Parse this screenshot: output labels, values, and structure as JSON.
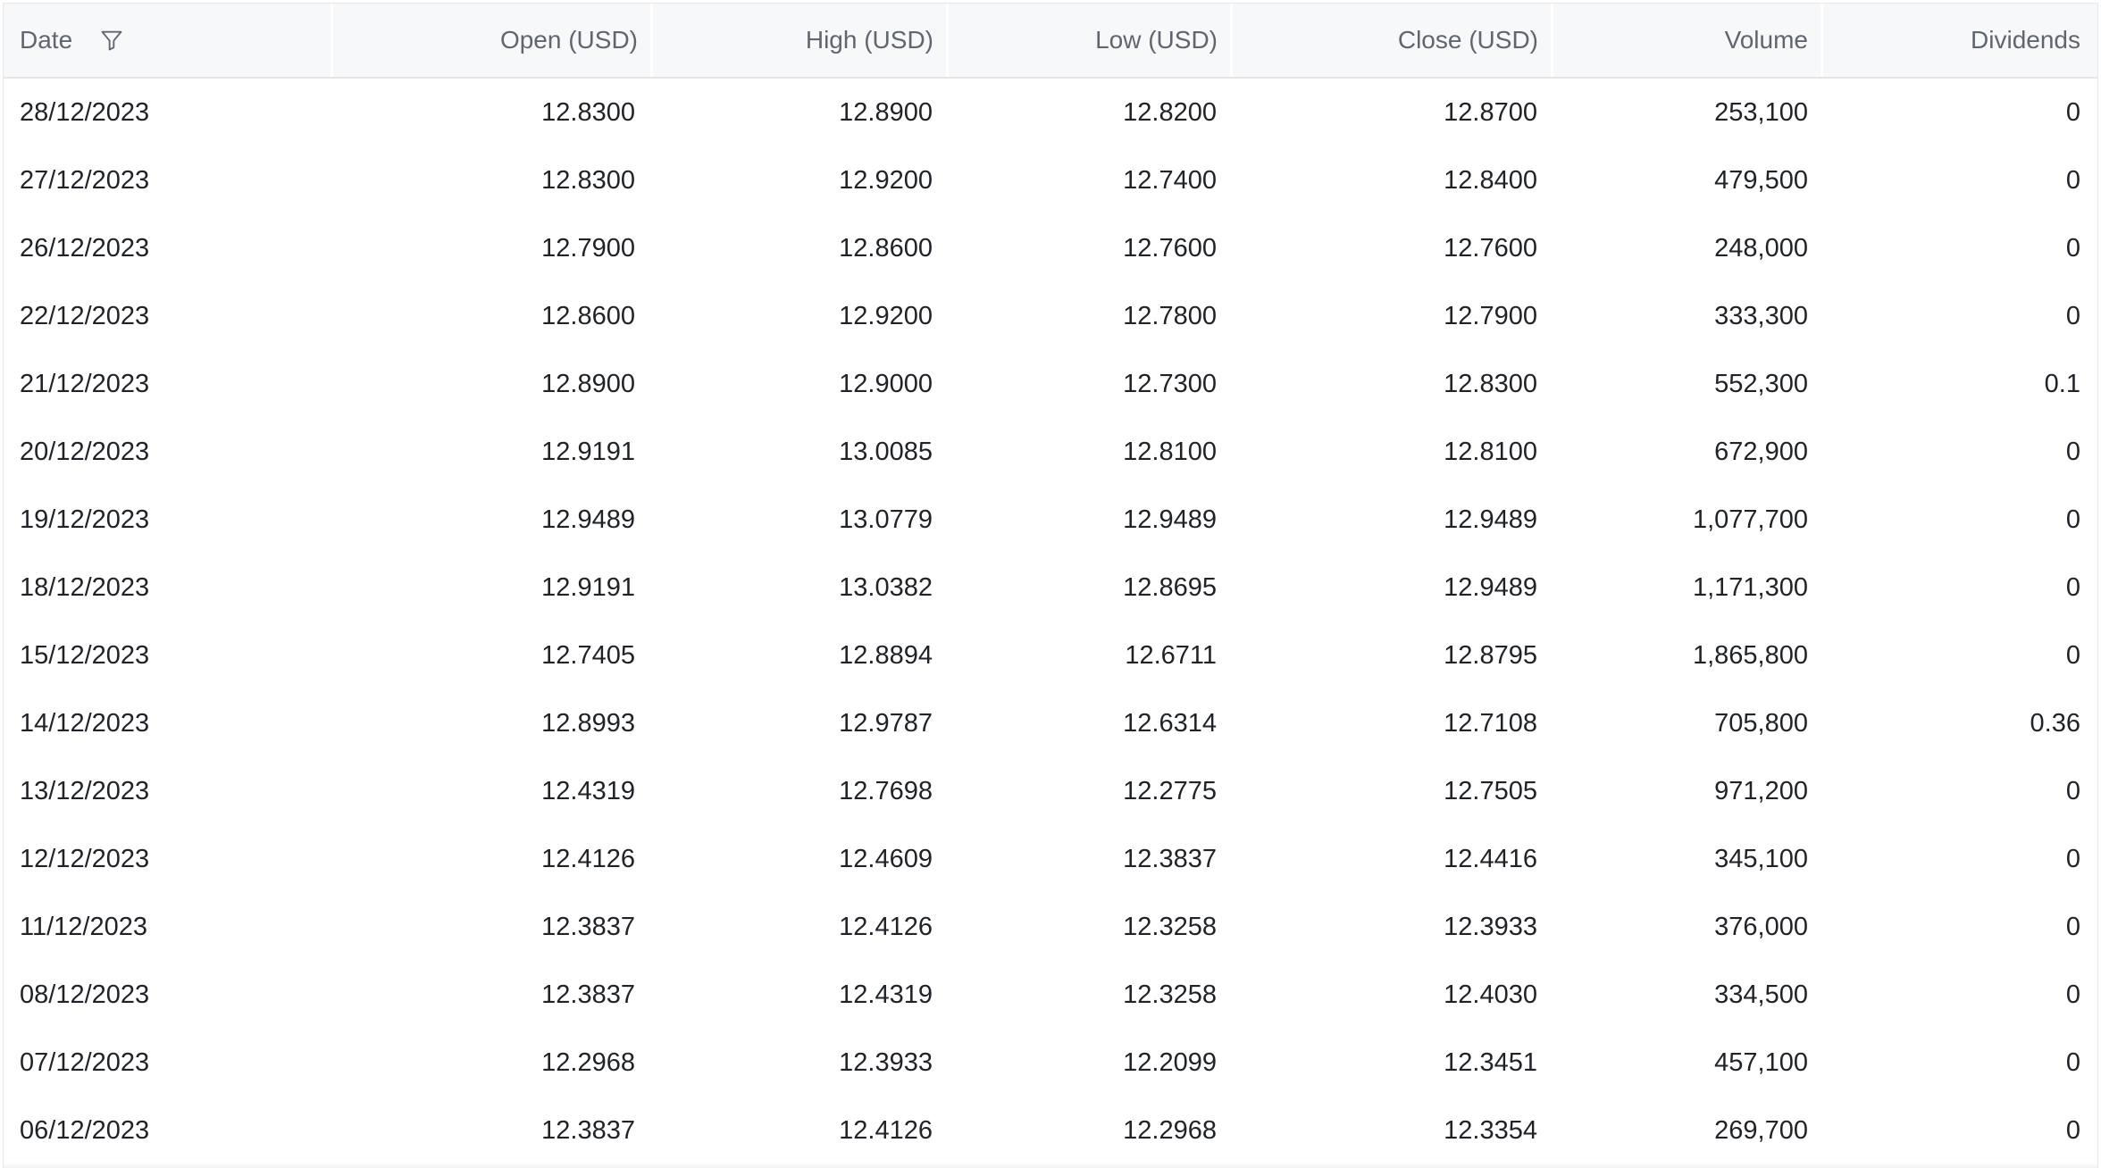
{
  "table": {
    "columns": [
      {
        "key": "date",
        "label": "Date",
        "align": "left",
        "filter_icon": "filter-icon"
      },
      {
        "key": "open",
        "label": "Open (USD)",
        "align": "right"
      },
      {
        "key": "high",
        "label": "High (USD)",
        "align": "right"
      },
      {
        "key": "low",
        "label": "Low (USD)",
        "align": "right"
      },
      {
        "key": "close",
        "label": "Close (USD)",
        "align": "right"
      },
      {
        "key": "volume",
        "label": "Volume",
        "align": "right"
      },
      {
        "key": "dividends",
        "label": "Dividends",
        "align": "right"
      }
    ],
    "rows": [
      [
        "28/12/2023",
        "12.8300",
        "12.8900",
        "12.8200",
        "12.8700",
        "253,100",
        "0"
      ],
      [
        "27/12/2023",
        "12.8300",
        "12.9200",
        "12.7400",
        "12.8400",
        "479,500",
        "0"
      ],
      [
        "26/12/2023",
        "12.7900",
        "12.8600",
        "12.7600",
        "12.7600",
        "248,000",
        "0"
      ],
      [
        "22/12/2023",
        "12.8600",
        "12.9200",
        "12.7800",
        "12.7900",
        "333,300",
        "0"
      ],
      [
        "21/12/2023",
        "12.8900",
        "12.9000",
        "12.7300",
        "12.8300",
        "552,300",
        "0.1"
      ],
      [
        "20/12/2023",
        "12.9191",
        "13.0085",
        "12.8100",
        "12.8100",
        "672,900",
        "0"
      ],
      [
        "19/12/2023",
        "12.9489",
        "13.0779",
        "12.9489",
        "12.9489",
        "1,077,700",
        "0"
      ],
      [
        "18/12/2023",
        "12.9191",
        "13.0382",
        "12.8695",
        "12.9489",
        "1,171,300",
        "0"
      ],
      [
        "15/12/2023",
        "12.7405",
        "12.8894",
        "12.6711",
        "12.8795",
        "1,865,800",
        "0"
      ],
      [
        "14/12/2023",
        "12.8993",
        "12.9787",
        "12.6314",
        "12.7108",
        "705,800",
        "0.36"
      ],
      [
        "13/12/2023",
        "12.4319",
        "12.7698",
        "12.2775",
        "12.7505",
        "971,200",
        "0"
      ],
      [
        "12/12/2023",
        "12.4126",
        "12.4609",
        "12.3837",
        "12.4416",
        "345,100",
        "0"
      ],
      [
        "11/12/2023",
        "12.3837",
        "12.4126",
        "12.3258",
        "12.3933",
        "376,000",
        "0"
      ],
      [
        "08/12/2023",
        "12.3837",
        "12.4319",
        "12.3258",
        "12.4030",
        "334,500",
        "0"
      ],
      [
        "07/12/2023",
        "12.2968",
        "12.3933",
        "12.2099",
        "12.3451",
        "457,100",
        "0"
      ],
      [
        "06/12/2023",
        "12.3837",
        "12.4126",
        "12.2968",
        "12.3354",
        "269,700",
        "0"
      ]
    ]
  }
}
